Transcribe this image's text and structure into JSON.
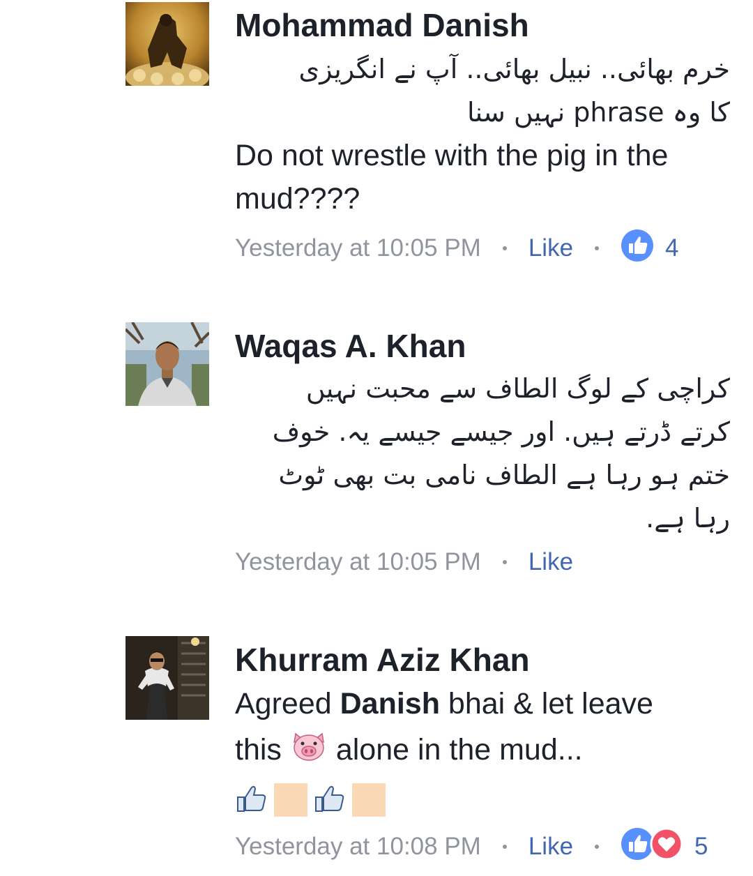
{
  "comments": [
    {
      "author": "Mohammad Danish",
      "text_urdu_1": "خرم بھائی.. نبیل بھائی.. آپ نے انگریزی",
      "text_urdu_2": "کا وہ phrase نہیں سنا",
      "text_en_1": "Do not wrestle with the pig in the",
      "text_en_2": "mud????",
      "time": "Yesterday at 10:05 PM",
      "like_label": "Like",
      "reaction_count": "4",
      "avatar_icon": "man-kneeling-on-skulls-avatar"
    },
    {
      "author": "Waqas A. Khan",
      "text_urdu_1": "کراچی کے لوگ الطاف سے محبت نہیں",
      "text_urdu_2": "کرتے ڈرتے ہیں. اور جیسے جیسے یہ. خوف",
      "text_urdu_3": "ختم ہو رہا ہے الطاف نامی بت بھی ٹوٹ",
      "text_urdu_4": "رہا ہے.",
      "time": "Yesterday at 10:05 PM",
      "like_label": "Like",
      "avatar_icon": "man-in-suit-outdoor-avatar"
    },
    {
      "author": "Khurram Aziz Khan",
      "text_p1": "Agreed ",
      "text_mention": "Danish",
      "text_p2": " bhai & let leave",
      "text_p3": "this ",
      "text_p4": " alone in the mud...",
      "pig_icon": "pig-face-emoji",
      "thumbs_icon": "thumbs-up-outline-emoji",
      "time": "Yesterday at 10:08 PM",
      "like_label": "Like",
      "reaction_count": "5",
      "avatar_icon": "man-standing-dark-background-avatar"
    }
  ],
  "colors": {
    "text": "#1d2129",
    "meta_gray": "#90949c",
    "link_blue": "#4267b2",
    "like_blue": "#5890ff",
    "love_red": "#f25268",
    "skin_tone": "#fbd9b7"
  }
}
